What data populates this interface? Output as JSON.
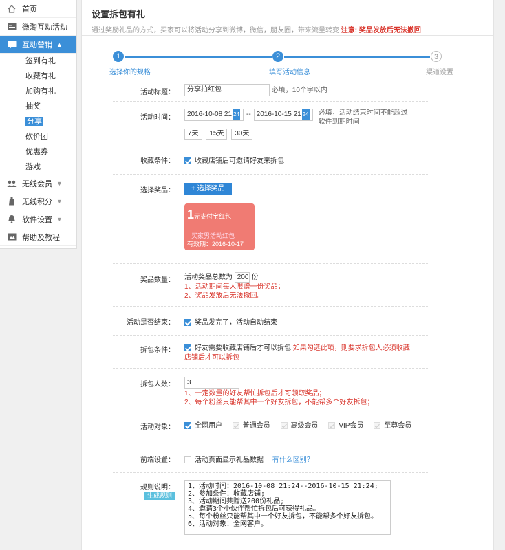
{
  "sidebar": {
    "items": [
      {
        "label": "首页",
        "icon": "home-icon"
      },
      {
        "label": "微淘互动活动",
        "icon": "card-icon"
      },
      {
        "label": "互动营销",
        "icon": "chat-icon",
        "chevron": "^"
      },
      {
        "label": "无线会员",
        "icon": "group-icon",
        "chevron": "v"
      },
      {
        "label": "无线积分",
        "icon": "bottle-icon",
        "chevron": "v"
      },
      {
        "label": "软件设置",
        "icon": "bell-icon",
        "chevron": "v"
      },
      {
        "label": "帮助及教程",
        "icon": "image-icon"
      }
    ],
    "subitems": [
      "签到有礼",
      "收藏有礼",
      "加购有礼",
      "抽奖",
      "分享",
      "砍价团",
      "优惠券",
      "游戏"
    ]
  },
  "header": {
    "title": "设置拆包有礼",
    "desc": "通过奖励礼品的方式，买家可以将活动分享到微博，微信，朋友圈，带来流量转变",
    "warn": "注意: 奖品发放后无法撤回"
  },
  "steps": [
    {
      "num": "1",
      "label": "选择你的规格"
    },
    {
      "num": "2",
      "label": "填写活动信息"
    },
    {
      "num": "3",
      "label": "渠道设置"
    }
  ],
  "form": {
    "title_label": "活动标题：",
    "title_value": "分享拍红包",
    "title_hint": "必填，10个字以内",
    "time_label": "活动时间：",
    "time_start": "2016-10-08 21",
    "time_sep": "--",
    "time_end": "2016-10-15 21",
    "time_hint": "必填，活动结束时间不能超过软件到期时间",
    "quick": [
      "7天",
      "15天",
      "30天"
    ],
    "collect_label": "收藏条件：",
    "collect_text": "收藏店铺后可邀请好友来拆包",
    "prize_label": "选择奖品：",
    "prize_btn": "+ 选择奖品",
    "coupon_amount": "1",
    "coupon_unit": "元支付宝红包",
    "coupon_line1": "买家男活动红包",
    "coupon_line2": "有效期：2016-10-17",
    "qty_label": "奖品数量：",
    "qty_text": "活动奖品总数为",
    "qty_value": "200",
    "qty_unit": "份",
    "qty_note1": "1、活动期间每人限赠一份奖品；",
    "qty_note2": "2、奖品发放后无法撤回。",
    "end_label": "活动是否结束：",
    "end_text": "奖品发完了，活动自动结束",
    "cond_label": "拆包条件：",
    "cond_text": "好友需要收藏店铺后才可以拆包",
    "cond_red": "如果勾选此项，则要求拆包人必须收藏店铺后才可以拆包",
    "people_label": "拆包人数：",
    "people_value": "3",
    "people_note1": "1、一定数量的好友帮忙拆包后才可领取奖品；",
    "people_note2": "2、每个粉丝只能帮其中一个好友拆包，不能帮多个好友拆包；",
    "target_label": "活动对象：",
    "targets": [
      "全网用户",
      "普通会员",
      "高级会员",
      "VIP会员",
      "至尊会员"
    ],
    "front_label": "前端设置：",
    "front_text": "活动页面显示礼品数据",
    "front_link": "有什么区别？",
    "rules_label": "规则说明：",
    "rules_btn": "生成规则",
    "rules_text": "1、活动时间：2016-10-08 21:24--2016-10-15 21:24;\n2、参加条件：收藏店铺;\n3、活动期间共赠送200份礼品;\n4、邀请3个小伙伴帮忙拆包后可获得礼品。\n5、每个粉丝只能帮其中一个好友拆包，不能帮多个好友拆包。\n6、活动对象：全网客户。"
  },
  "colors": {
    "accent": "#3b8fd8",
    "warn": "#d9342b",
    "coupon": "#f07b73"
  }
}
